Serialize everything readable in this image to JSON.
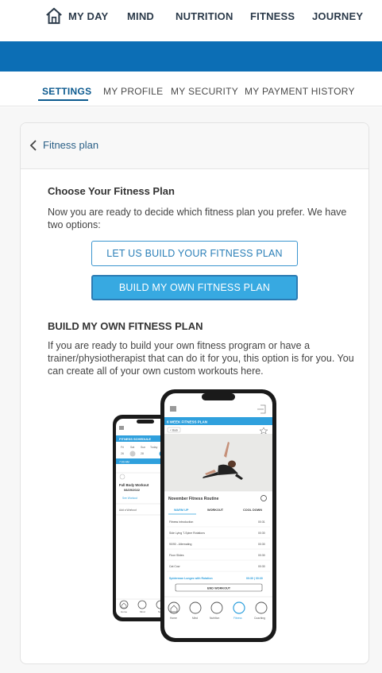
{
  "topnav": {
    "items": [
      "MY DAY",
      "MIND",
      "NUTRITION",
      "FITNESS",
      "JOURNEY"
    ]
  },
  "subtabs": {
    "items": [
      "SETTINGS",
      "MY PROFILE",
      "MY SECURITY",
      "MY PAYMENT HISTORY"
    ],
    "active": "SETTINGS"
  },
  "card": {
    "back_label": "Fitness plan",
    "choose_heading": "Choose Your Fitness Plan",
    "choose_text": "Now you are ready to decide which fitness plan you prefer. We have two options:",
    "btn_build_for_me": "LET US BUILD YOUR FITNESS PLAN",
    "btn_build_own": "BUILD MY OWN FITNESS PLAN",
    "build_heading": "BUILD MY OWN FITNESS PLAN",
    "build_text": "If you are ready to build your own fitness program or have a trainer/physiotherapist that can do it for you, this option is for you. You can create all of your own custom workouts here."
  },
  "phone_back": {
    "header": "FITNESS SCHEDULE",
    "days": [
      "Fri",
      "Sat",
      "Sun",
      "Today"
    ],
    "dates": [
      "26",
      "27",
      "28",
      "29"
    ],
    "time": "7:00 AM",
    "workout_title": "Full Body Workout",
    "workout_date": "08/29/2022",
    "add_workout": "Add a Workout",
    "see_workout": "See Workout",
    "nav": [
      "Home",
      "Mind",
      "Nutr"
    ]
  },
  "phone_front": {
    "header": "6 WEEK FITNESS PLAN",
    "back_btn": "< Back",
    "routine_title": "November Fitness Routine",
    "tabs": [
      "WARM UP",
      "WORKOUT",
      "COOL DOWN"
    ],
    "rows": [
      {
        "name": "Fitness introduction",
        "time": "00:31"
      },
      {
        "name": "Side Lying T-Spine Rotations",
        "time": "00:30"
      },
      {
        "name": "90/90 - Alternating",
        "time": "00:30"
      },
      {
        "name": "Floor Slides",
        "time": "00:30"
      },
      {
        "name": "Cat Cow",
        "time": "00:30"
      }
    ],
    "highlight_row": {
      "name": "Spiderman Lunges with Rotation",
      "time": "00:30 | 00:30"
    },
    "end_btn": "END WORKOUT",
    "nav": [
      "Home",
      "Mind",
      "Nutrition",
      "Fitness",
      "Coaching"
    ]
  },
  "colors": {
    "brand_blue": "#0c6eb5",
    "accent_blue": "#37a9e1",
    "link_blue": "#2a5f86"
  }
}
